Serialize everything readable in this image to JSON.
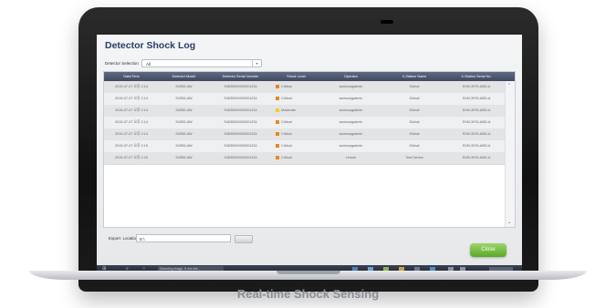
{
  "window": {
    "title": "Detector Shock Log",
    "close_label": "Close"
  },
  "filter": {
    "label": "Detector Selection",
    "value": "All"
  },
  "table": {
    "columns": [
      "Date/Time",
      "Detector Model",
      "Detector Serial Number",
      "Shock Level",
      "Operator",
      "X-Station Name",
      "X-Station Serial No."
    ],
    "rows": [
      [
        "2015-07-07 오후 2:14",
        "S4355-AW",
        "S4535000000001234",
        "Critical",
        "samsungadmin",
        "Global",
        "SVM-3976-ABD-A"
      ],
      [
        "2015-07-07 오후 2:14",
        "S4355-AW",
        "S4535000000001234",
        "Critical",
        "samsungadmin",
        "Global",
        "SVM-3976-ABD-A"
      ],
      [
        "2015-07-07 오후 2:14",
        "S4355-AW",
        "S4535000000001234",
        "Moderate",
        "samsungadmin",
        "Global",
        "SVM-3976-ABD-A"
      ],
      [
        "2015-07-07 오후 2:14",
        "S4355-AW",
        "S4535000000001234",
        "Critical",
        "samsungadmin",
        "Global",
        "SVM-3976-ABD-A"
      ],
      [
        "2015-07-07 오후 2:14",
        "S4355-AW",
        "S4535000000001234",
        "Critical",
        "samsungadmin",
        "Global",
        "SVM-3976-ABD-A"
      ],
      [
        "2015-07-07 오후 2:15",
        "S4355-AW",
        "S4535000000001234",
        "Critical",
        "samsungadmin",
        "Global",
        "SVM-3976-ABD-A"
      ],
      [
        "2015-07-07 오후 2:15",
        "S4355-AW",
        "S4535000000001234",
        "Critical",
        "Lesser",
        "Test Device",
        "SVM-3976-ABD-A"
      ]
    ],
    "level_colors": {
      "Critical": "#e8871f",
      "Moderate": "#f0d21d"
    }
  },
  "export": {
    "label": "Export",
    "location_label": "Location",
    "location_value": "E:\\"
  },
  "taskbar": {
    "status_text": "Detecting image, 8 min left..."
  },
  "caption": "Real-time Shock Sensing",
  "colors": {
    "header": "#4b566e",
    "accent_green": "#6cb33a",
    "title": "#2a3d66"
  }
}
